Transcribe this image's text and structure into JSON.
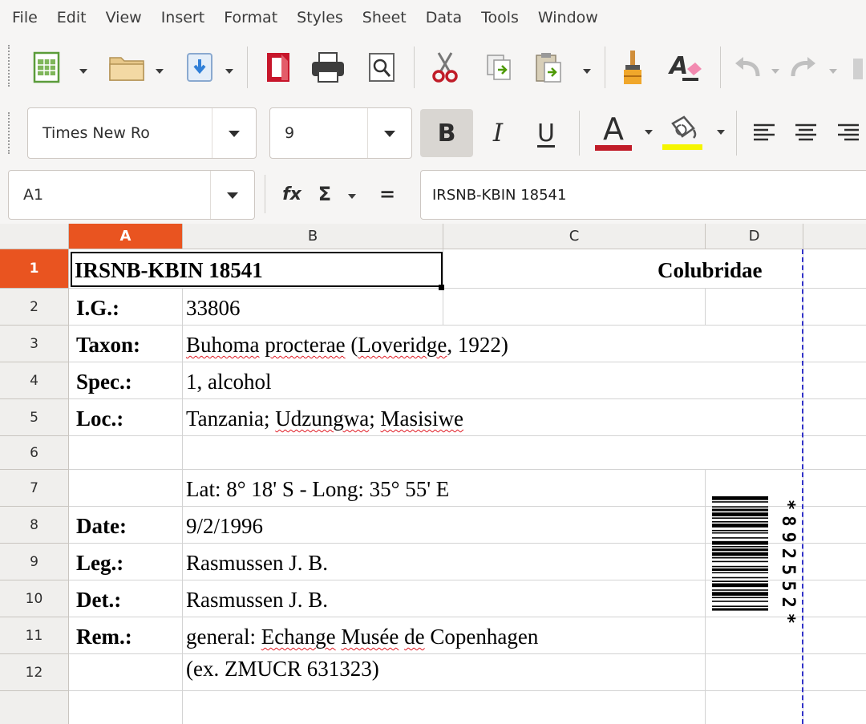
{
  "menu": [
    "File",
    "Edit",
    "View",
    "Insert",
    "Format",
    "Styles",
    "Sheet",
    "Data",
    "Tools",
    "Window"
  ],
  "toolbar": {
    "font_name": "Times New Ro",
    "font_size": "9",
    "bold_label": "B",
    "italic_label": "I",
    "underline_label": "U",
    "font_color_label": "A",
    "font_color": "#c01c28",
    "highlight_color": "#f5f500"
  },
  "formula_bar": {
    "cell_ref": "A1",
    "fx_label": "fx",
    "sum_label": "Σ",
    "equals_label": "=",
    "content": "IRSNB-KBIN 18541"
  },
  "grid": {
    "columns": [
      "A",
      "B",
      "C",
      "D"
    ],
    "rows": [
      "1",
      "2",
      "3",
      "4",
      "5",
      "6",
      "7",
      "8",
      "9",
      "10",
      "11",
      "12"
    ],
    "selected_column": "A",
    "selected_row": "1",
    "cells": {
      "a1": "IRSNB-KBIN 18541",
      "d1": "Colubridae",
      "a2": "I.G.:",
      "b2": "33806",
      "a3": "Taxon:",
      "b3_genus": "Buhoma",
      "b3_species": "procterae",
      "b3_open": "(",
      "b3_author": "Loveridge",
      "b3_year": ", 1922)",
      "a4": "Spec.:",
      "b4": "1, alcohol",
      "a5": "Loc.:",
      "b5_country": "Tanzania; ",
      "b5_region": "Udzungwa",
      "b5_sep": "; ",
      "b5_site": "Masisiwe",
      "b7": "Lat: 8° 18' S - Long: 35° 55' E",
      "a8": "Date:",
      "b8": "9/2/1996",
      "a9": "Leg.:",
      "b9": "Rasmussen J. B.",
      "a10": "Det.:",
      "b10": "Rasmussen J. B.",
      "a11": "Rem.:",
      "b11_pre": "general: ",
      "b11_w1": "Echange",
      "b11_sp1": " ",
      "b11_w2": "Musée",
      "b11_sp2": " ",
      "b11_w3": "de",
      "b11_post": " Copenhagen",
      "b12": "(ex. ZMUCR 631323)"
    },
    "barcode_text": "*892552*"
  }
}
